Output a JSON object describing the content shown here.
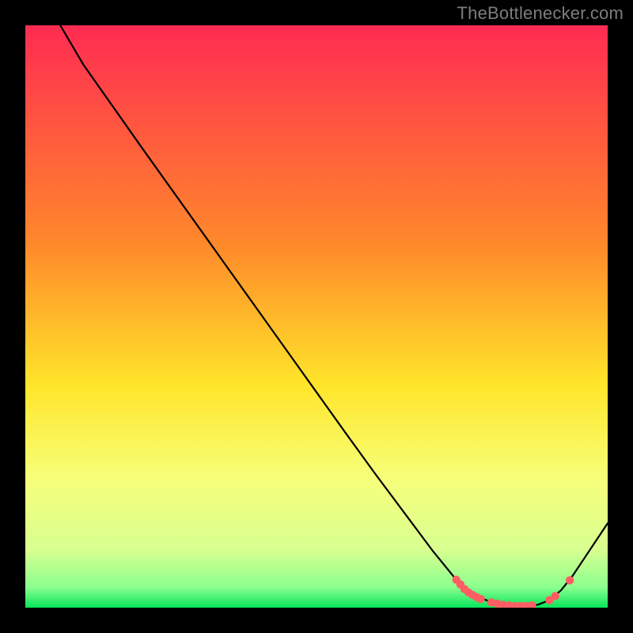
{
  "attribution": "TheBottlenecker.com",
  "colors": {
    "background_black": "#000000",
    "grad_top": "#ff2b52",
    "grad_mid_upper": "#ff8a2a",
    "grad_mid": "#ffe62a",
    "grad_mid_lower": "#f6ff7a",
    "grad_low1": "#d8ff90",
    "grad_bottom": "#07e55b",
    "curve": "#000000",
    "dot_fill": "#ff5e63",
    "dot_stroke": "#ff5e63"
  },
  "chart_data": {
    "type": "line",
    "title": "",
    "xlabel": "",
    "ylabel": "",
    "xlim": [
      0,
      100
    ],
    "ylim": [
      0,
      100
    ],
    "gradient_stops": [
      {
        "offset": 0.0,
        "color": "#ff2b52"
      },
      {
        "offset": 0.38,
        "color": "#ff8a2a"
      },
      {
        "offset": 0.62,
        "color": "#ffe62a"
      },
      {
        "offset": 0.78,
        "color": "#f6ff7a"
      },
      {
        "offset": 0.9,
        "color": "#d8ff90"
      },
      {
        "offset": 0.965,
        "color": "#8bff8e"
      },
      {
        "offset": 1.0,
        "color": "#07e55b"
      }
    ],
    "series": [
      {
        "name": "curve",
        "x": [
          6,
          10,
          15,
          20,
          25,
          30,
          35,
          40,
          45,
          50,
          55,
          60,
          65,
          70,
          74,
          77,
          80,
          83,
          86,
          88,
          90,
          92,
          94,
          96,
          100
        ],
        "y": [
          100,
          93.2,
          86.1,
          79.0,
          72.0,
          65.0,
          58.0,
          51.0,
          44.0,
          37.0,
          30.0,
          23.1,
          16.4,
          9.7,
          4.8,
          2.3,
          0.9,
          0.3,
          0.3,
          0.5,
          1.3,
          3.0,
          5.5,
          8.5,
          14.5
        ]
      }
    ],
    "dots": {
      "name": "highlight-range",
      "x": [
        74.0,
        74.7,
        75.4,
        76.1,
        76.8,
        77.5,
        78.2,
        80.0,
        81.0,
        82.0,
        83.0,
        84.0,
        85.0,
        86.0,
        87.0,
        90.0,
        91.0,
        93.5
      ],
      "y": [
        4.8,
        4.0,
        3.2,
        2.6,
        2.2,
        1.8,
        1.5,
        0.9,
        0.7,
        0.5,
        0.4,
        0.3,
        0.3,
        0.3,
        0.4,
        1.3,
        2.0,
        4.7
      ]
    },
    "dot_radius": 5.2
  }
}
